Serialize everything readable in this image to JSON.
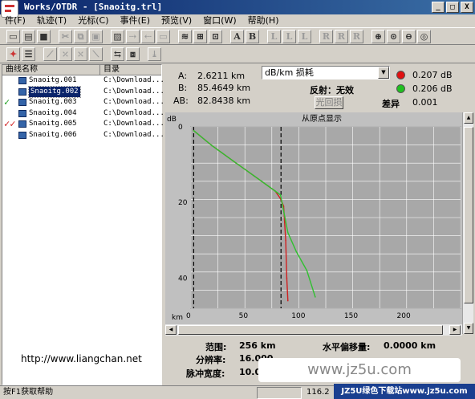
{
  "window": {
    "title": "Works/OTDR - [Snaoitg.trl]",
    "controls": [
      "_",
      "□",
      "X"
    ]
  },
  "menu": [
    "件(F)",
    "轨迹(T)",
    "光标(C)",
    "事件(E)",
    "预览(V)",
    "窗口(W)",
    "帮助(H)"
  ],
  "toolbar1": [
    "A",
    "B",
    "L",
    "L",
    "L",
    "R",
    "R",
    "R"
  ],
  "list": {
    "col_name": "曲线名称",
    "col_dir": "目录",
    "rows": [
      {
        "name": "Snaoitg.001",
        "dir": "C:\\Download...",
        "check": ""
      },
      {
        "name": "Snaoitg.002",
        "dir": "C:\\Download...",
        "check": ""
      },
      {
        "name": "Snaoitg.003",
        "dir": "C:\\Download...",
        "check": "✓"
      },
      {
        "name": "Snaoitg.004",
        "dir": "C:\\Download...",
        "check": ""
      },
      {
        "name": "Snaoitg.005",
        "dir": "C:\\Download...",
        "check": "✓✓"
      },
      {
        "name": "Snaoitg.006",
        "dir": "C:\\Download...",
        "check": ""
      }
    ]
  },
  "url": "http://www.liangchan.net",
  "readout": {
    "A_label": "A:",
    "A_val": "2.6211 km",
    "B_label": "B:",
    "B_val": "85.4649 km",
    "AB_label": "AB:",
    "AB_val": "82.8438 km",
    "mode": "dB/km 损耗",
    "reflect_label": "反射：无效",
    "reflect_btn": "光回损",
    "red_val": "0.207 dB",
    "green_val": "0.206 dB",
    "diff_label": "差异",
    "diff_val": "0.001"
  },
  "chart_data": {
    "type": "line",
    "title": "从原点显示",
    "xlabel": "km",
    "ylabel": "dB",
    "x_ticks": [
      0,
      50,
      100,
      150,
      200
    ],
    "y_ticks": [
      0,
      20,
      40
    ],
    "xlim": [
      0,
      256
    ],
    "ylim": [
      0,
      48
    ],
    "series": [
      {
        "values": [
          [
            2.6,
            1
          ],
          [
            20,
            5
          ],
          [
            40,
            9
          ],
          [
            60,
            13
          ],
          [
            80,
            17
          ],
          [
            85,
            19
          ],
          [
            88,
            21
          ],
          [
            90,
            30
          ],
          [
            91,
            40
          ],
          [
            92,
            46
          ]
        ],
        "color": "#d02020"
      },
      {
        "values": [
          [
            2.6,
            1
          ],
          [
            20,
            5
          ],
          [
            40,
            9
          ],
          [
            60,
            13
          ],
          [
            80,
            17
          ],
          [
            85,
            18
          ],
          [
            92,
            28
          ],
          [
            100,
            33
          ],
          [
            110,
            38
          ],
          [
            118,
            45
          ]
        ],
        "color": "#30c030"
      }
    ],
    "markers": [
      2.6,
      85.5
    ]
  },
  "bottom": {
    "range_label": "范围:",
    "range_val": "256 km",
    "res_label": "分辨率:",
    "res_val": "16.000",
    "pulse_label": "脉冲宽度:",
    "pulse_val": "10.0",
    "hshift_label": "水平偏移量:",
    "hshift_val": "0.0000 km"
  },
  "watermark": "www.jz5u.com",
  "status": {
    "left": "按F1获取帮助",
    "mid": "116.2",
    "badge": "JZ5U绿色下载站www.jz5u.com"
  }
}
